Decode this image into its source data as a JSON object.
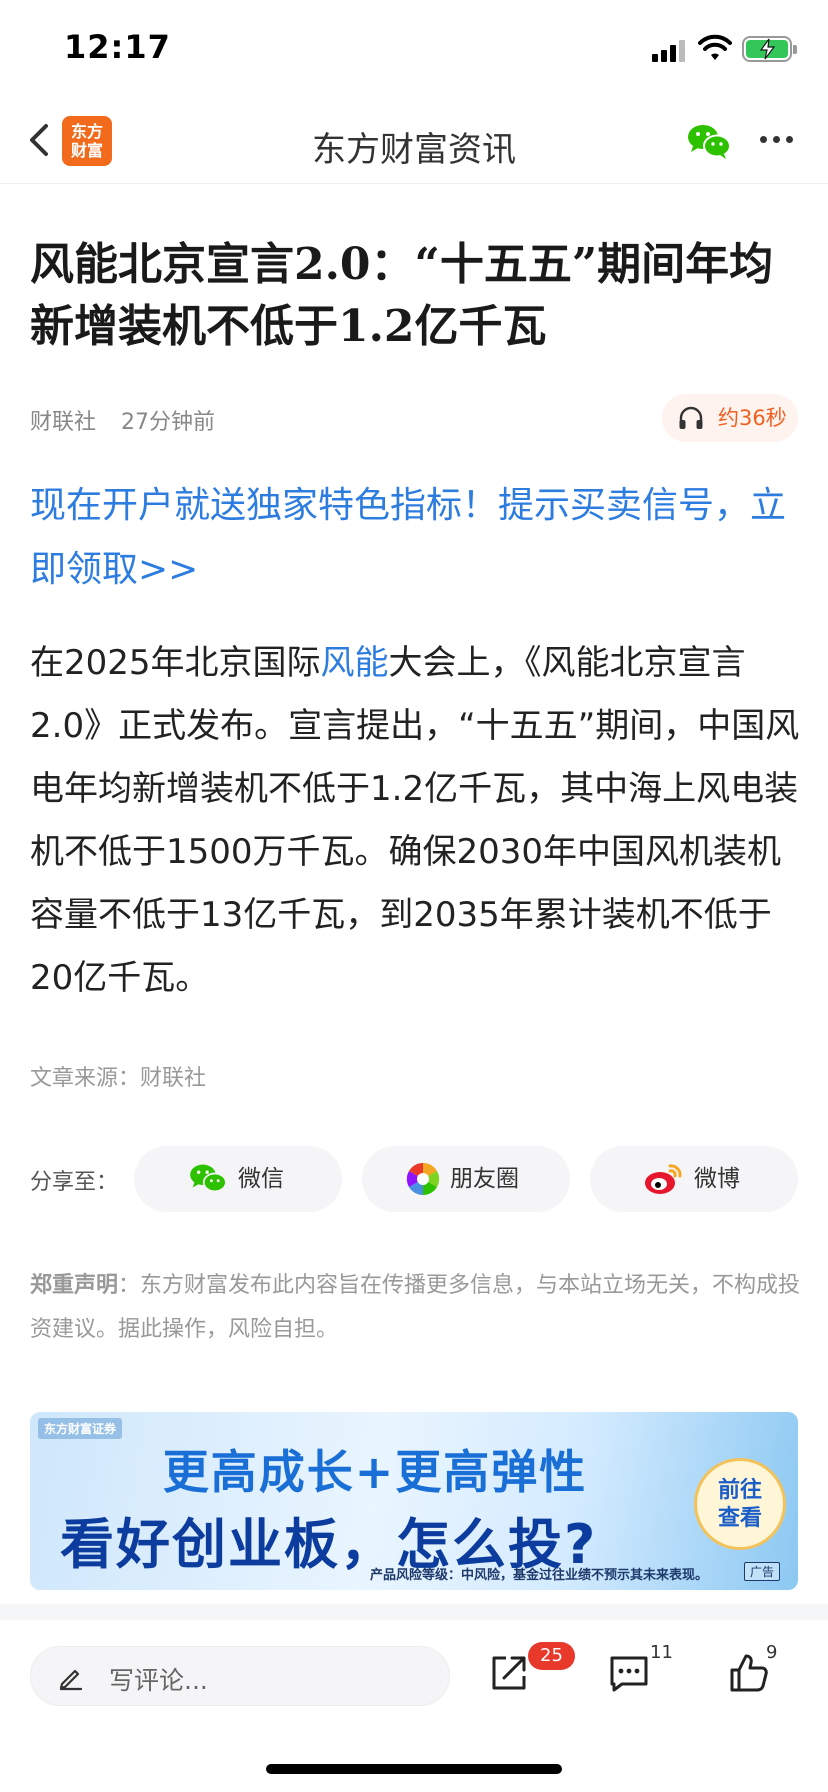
{
  "status": {
    "time": "12:17"
  },
  "nav": {
    "logo_line1": "东方",
    "logo_line2": "财富",
    "title": "东方财富资讯"
  },
  "article": {
    "headline": "风能北京宣言2.0：“十五五”期间年均新增装机不低于1.2亿千瓦",
    "source_name": "财联社",
    "time_ago": "27分钟前",
    "audio_duration": "约36秒",
    "promo_link": "现在开户就送独家特色指标！提示买卖信号，立即领取>>",
    "body_pre": "在2025年北京国际",
    "body_keyword": "风能",
    "body_post": "大会上，《风能北京宣言2.0》正式发布。宣言提出，“十五五”期间，中国风电年均新增装机不低于1.2亿千瓦，其中海上风电装机不低于1500万千瓦。确保2030年中国风机装机容量不低于13亿千瓦，到2035年累计装机不低于20亿千瓦。",
    "source_line": "文章来源：财联社"
  },
  "share": {
    "label": "分享至：",
    "wechat": "微信",
    "moments": "朋友圈",
    "weibo": "微博"
  },
  "disclaimer": {
    "title": "郑重声明",
    "text": "：东方财富发布此内容旨在传播更多信息，与本站立场无关，不构成投资建议。据此操作，风险自担。"
  },
  "ad": {
    "brand": "东方财富证券",
    "line1": "更高成长+更高弹性",
    "line2": "看好创业板，怎么投?",
    "cta_line1": "前往",
    "cta_line2": "查看",
    "risk": "产品风险等级：中风险，基金过往业绩不预示其未来表现。",
    "tag": "广告"
  },
  "bottom": {
    "comment_placeholder": "写评论...",
    "share_count": "25",
    "comment_count": "11",
    "like_count": "9"
  },
  "colors": {
    "brand_orange": "#f26b1d",
    "link_blue": "#2d7ce0",
    "badge_red": "#e8392b",
    "wechat_green": "#2dc100"
  }
}
